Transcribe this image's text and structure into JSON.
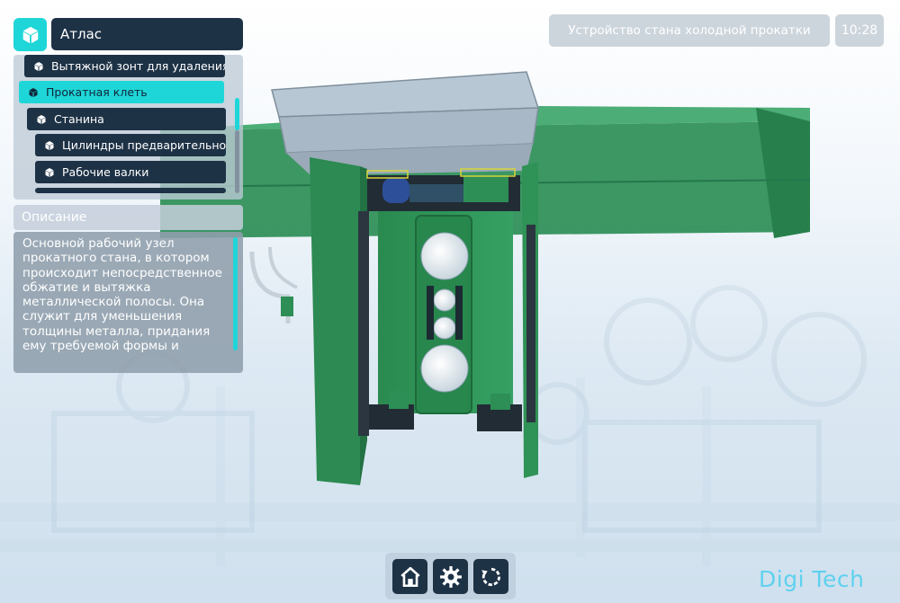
{
  "atlas": {
    "title": "Атлас",
    "logo_icon": "cube-icon",
    "items": [
      {
        "label": "Вытяжной зонт для удаления",
        "icon": "cube-icon"
      },
      {
        "label": "Прокатная клеть",
        "icon": "cube-icon",
        "selected": true
      },
      {
        "label": "Станина",
        "icon": "cube-icon"
      },
      {
        "label": "Цилиндры предварительного",
        "icon": "cube-icon"
      },
      {
        "label": "Рабочие валки",
        "icon": "cube-icon"
      }
    ]
  },
  "description": {
    "title": "Описание",
    "text": "Основной рабочий узел прокатного стана, в котором происходит непосредственное обжатие и вытяжка металлической полосы. Она служит для уменьшения толщины металла, придания ему требуемой формы и"
  },
  "header": {
    "scene_title": "Устройство стана холодной прокатки",
    "time": "10:28"
  },
  "toolbar": {
    "buttons": [
      {
        "name": "home-button",
        "icon": "home-icon"
      },
      {
        "name": "settings-button",
        "icon": "gear-icon"
      },
      {
        "name": "reset-view-button",
        "icon": "rotate-icon"
      }
    ]
  },
  "brand": {
    "text": "Digi Tech"
  },
  "colors": {
    "accent": "#1ed6d8",
    "panel_dark": "#1e3246",
    "machine_green": "#2e8b57",
    "brand": "#5fd1ee"
  }
}
